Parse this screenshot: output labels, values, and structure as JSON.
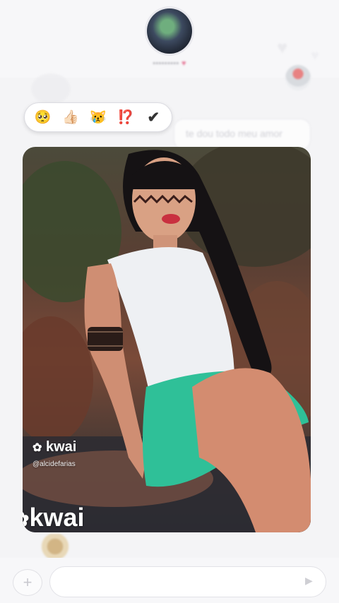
{
  "header": {
    "contact_name": "•••••••••",
    "name_heart": "♥"
  },
  "reactions": [
    {
      "name": "pleading-face",
      "glyph": "🥺"
    },
    {
      "name": "thumbs-up",
      "glyph": "👍🏻"
    },
    {
      "name": "crying-cat",
      "glyph": "😿"
    },
    {
      "name": "exclamation-question",
      "glyph": "⁉️"
    },
    {
      "name": "check",
      "glyph": "✔"
    }
  ],
  "message": {
    "text": "te dou todo meu amor"
  },
  "watermark": {
    "brand": "kwai",
    "handle": "@alcidefarias",
    "big_brand": "kwai"
  },
  "composer": {
    "placeholder": "",
    "value": ""
  },
  "colors": {
    "background": "#f4f4f6",
    "reaction_border": "#dcdce2",
    "accent_heart": "#e0527a"
  }
}
